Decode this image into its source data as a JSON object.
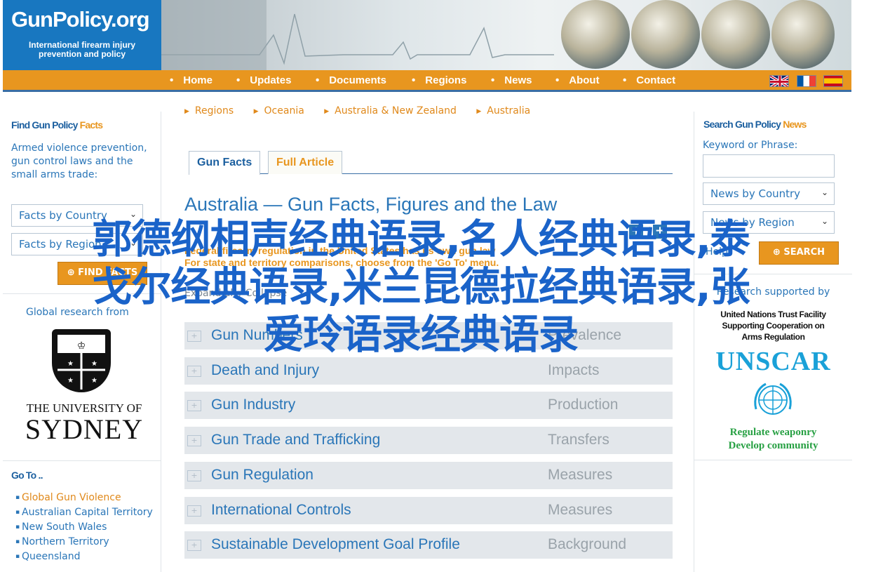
{
  "logo": {
    "title": "GunPolicy.org",
    "tagline_1": "International firearm injury",
    "tagline_2": "prevention and policy"
  },
  "nav": {
    "items": [
      "Home",
      "Updates",
      "Documents",
      "Regions",
      "News",
      "About",
      "Contact"
    ],
    "flags": [
      "uk-flag",
      "france-flag",
      "spain-flag"
    ]
  },
  "left_sidebar": {
    "facts_title_a": "Find Gun Policy ",
    "facts_title_b": "Facts",
    "facts_desc": "Armed violence prevention, gun control laws and the small arms trade:",
    "facts_select": "Facts by Country",
    "facts_select2": "Facts by Region",
    "find_button": "FIND FACTS",
    "research_text": "Global research from",
    "usyd_line1": "THE UNIVERSITY OF",
    "usyd_line2": "SYDNEY",
    "goto_title": "Go To ..",
    "goto_items": [
      "Global Gun Violence",
      "Australian Capital Territory",
      "New South Wales",
      "Northern Territory",
      "Queensland"
    ]
  },
  "breadcrumbs": [
    "Regions",
    "Oceania",
    "Australia & New Zealand",
    "Australia"
  ],
  "tabs": {
    "gun_facts": "Gun Facts",
    "full_article": "Full Article"
  },
  "main": {
    "title": "Australia — Gun Facts, Figures and the Law",
    "intro_1": "Federal firearm regulation in the United States has its own gun law",
    "intro_2": "For state and territory comparisons, choose from the 'Go To' menu.",
    "expand_collapse": "Expand all / Collapse",
    "add_icon_1": "+",
    "add_icon_2": "+",
    "rows": [
      {
        "label": "Gun Numbers",
        "sub": "Prevalence",
        "plus": "+"
      },
      {
        "label": "Death and Injury",
        "sub": "Impacts",
        "plus": "+"
      },
      {
        "label": "Gun Industry",
        "sub": "Production",
        "plus": "+"
      },
      {
        "label": "Gun Trade and Trafficking",
        "sub": "Transfers",
        "plus": "+"
      },
      {
        "label": "Gun Regulation",
        "sub": "Measures",
        "plus": "+"
      },
      {
        "label": "International Controls",
        "sub": "Measures",
        "plus": "+"
      },
      {
        "label": "Sustainable Development Goal Profile",
        "sub": "Background",
        "plus": "+"
      }
    ]
  },
  "right_sidebar": {
    "title_a": "Search Gun Policy ",
    "title_b": "News",
    "keyword_label": "Keyword or Phrase:",
    "keyword_value": "",
    "select_country": "News by Country",
    "select_region": "News by Region",
    "help": "Help",
    "search_button": "SEARCH",
    "supported_by": "Research supported by",
    "unrta_1": "United Nations Trust Facility",
    "unrta_2": "Supporting Cooperation on",
    "unrta_3": "Arms Regulation",
    "unscar": "UNSCAR",
    "slogan_1": "Regulate weaponry",
    "slogan_2": "Develop community"
  },
  "overlay_text": {
    "line1": "郭德纲相声经典语录,名人经典语录,泰",
    "line2": "戈尔经典语录,米兰昆德拉经典语录,张",
    "line3": "爱玲语录经典语录"
  },
  "colors": {
    "brand_blue": "#1877c0",
    "nav_orange": "#e8961f",
    "link_blue": "#2a76b8",
    "overlay_blue": "#1a63c9"
  }
}
